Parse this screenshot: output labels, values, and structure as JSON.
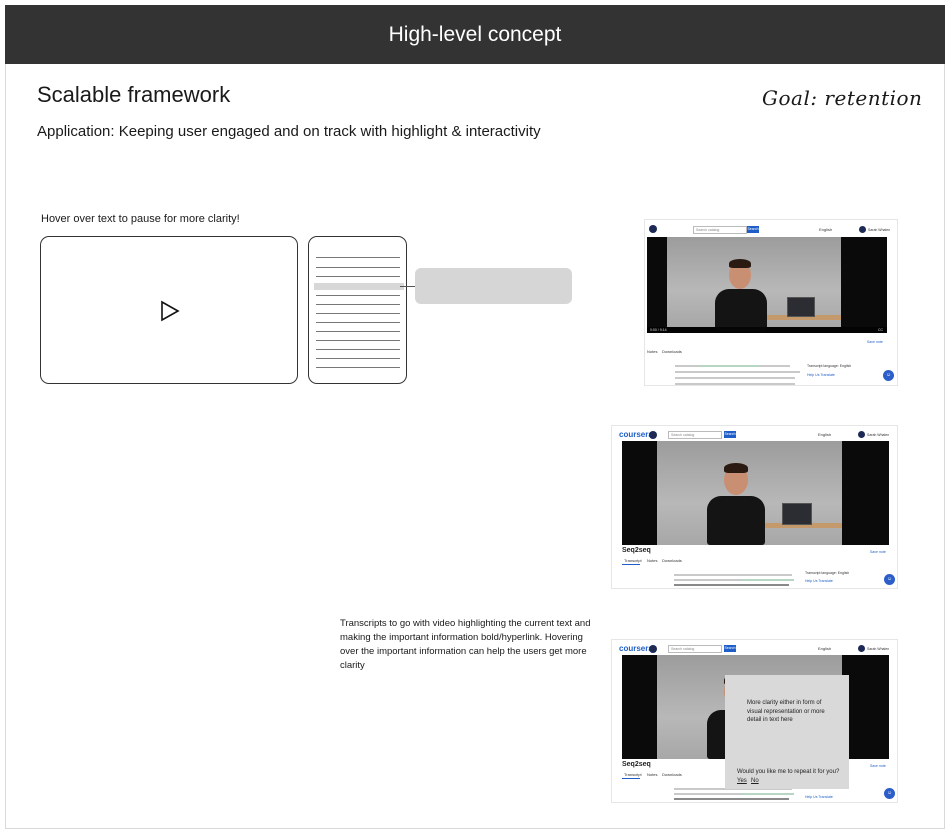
{
  "header": {
    "title": "High-level concept"
  },
  "section": {
    "heading": "Scalable framework",
    "subheading": "Application: Keeping user engaged and on track with highlight & interactivity",
    "goal": "Goal: retention"
  },
  "wireframe": {
    "hover_label": "Hover over text to pause for more clarity!",
    "play_icon": "play-icon"
  },
  "transcript_note": "Transcripts to go with video highlighting the current text and making the important information bold/hyperlink. Hovering over the important information can help the users get more clarity",
  "mockups": {
    "brand": "coursera",
    "search_placeholder": "Search catalog",
    "search_button": "Search",
    "language": "English",
    "user": "Sarah Whalen",
    "lesson_title": "Seq2seq",
    "tabs": [
      "Transcript",
      "Notes",
      "Downloads"
    ],
    "save_note": "Save note",
    "transcript_language": "Transcript language: English",
    "help_translate": "Help Us Translate",
    "video_time": "0:00 / 9:14",
    "cc_label": "CC"
  },
  "popup": {
    "message": "More clarity either in form of visual representation or more detail in text here",
    "question": "Would you like me to repeat it for you?",
    "yes": "Yes",
    "no": "No"
  },
  "colors": {
    "header_bg": "#333333",
    "accent": "#1f5ec8",
    "highlight": "#b8d6c4"
  }
}
